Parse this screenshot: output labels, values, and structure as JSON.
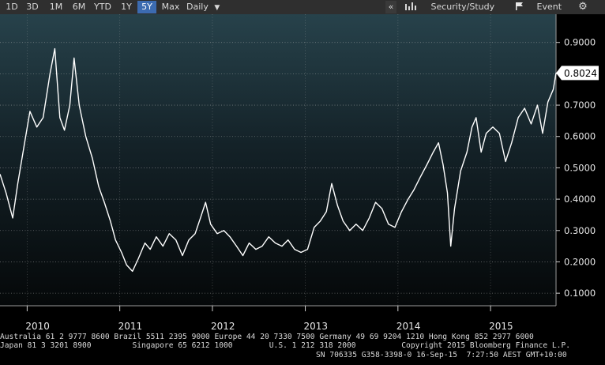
{
  "toolbar": {
    "ranges": [
      "1D",
      "3D",
      "1M",
      "6M",
      "YTD",
      "1Y",
      "5Y",
      "Max"
    ],
    "selected_range": "5Y",
    "frequency": "Daily",
    "collapse_glyph": "«",
    "security_study_label": "Security/Study",
    "event_label": "Event",
    "icons": [
      "dropdown-arrow-icon",
      "bar-chart-icon",
      "flag-icon",
      "gear-icon"
    ]
  },
  "chart_data": {
    "type": "line",
    "title": "",
    "xlabel": "",
    "ylabel": "",
    "x_tick_labels": [
      "2010",
      "2011",
      "2012",
      "2013",
      "2014",
      "2015"
    ],
    "y_tick_labels": [
      "0.1000",
      "0.2000",
      "0.3000",
      "0.4000",
      "0.5000",
      "0.6000",
      "0.7000",
      "0.8000",
      "0.9000"
    ],
    "ylim": [
      0.06,
      0.99
    ],
    "xlim": [
      "2009-09-16",
      "2015-09-16"
    ],
    "last_value_label": "0.8024",
    "last_value": 0.8024,
    "grid": true,
    "series": [
      {
        "color": "#ffffff",
        "points": [
          [
            "2009-09-16",
            0.48
          ],
          [
            "2009-10-10",
            0.42
          ],
          [
            "2009-11-05",
            0.34
          ],
          [
            "2009-11-25",
            0.45
          ],
          [
            "2009-12-20",
            0.57
          ],
          [
            "2010-01-12",
            0.68
          ],
          [
            "2010-02-08",
            0.63
          ],
          [
            "2010-03-05",
            0.66
          ],
          [
            "2010-04-01",
            0.8
          ],
          [
            "2010-04-20",
            0.88
          ],
          [
            "2010-05-10",
            0.66
          ],
          [
            "2010-05-28",
            0.62
          ],
          [
            "2010-06-18",
            0.7
          ],
          [
            "2010-07-05",
            0.85
          ],
          [
            "2010-07-25",
            0.7
          ],
          [
            "2010-08-20",
            0.6
          ],
          [
            "2010-09-15",
            0.53
          ],
          [
            "2010-10-10",
            0.44
          ],
          [
            "2010-11-01",
            0.39
          ],
          [
            "2010-11-25",
            0.33
          ],
          [
            "2010-12-15",
            0.27
          ],
          [
            "2011-01-08",
            0.23
          ],
          [
            "2011-01-28",
            0.19
          ],
          [
            "2011-02-20",
            0.17
          ],
          [
            "2011-03-15",
            0.21
          ],
          [
            "2011-04-10",
            0.26
          ],
          [
            "2011-05-01",
            0.24
          ],
          [
            "2011-05-25",
            0.28
          ],
          [
            "2011-06-20",
            0.25
          ],
          [
            "2011-07-15",
            0.29
          ],
          [
            "2011-08-10",
            0.27
          ],
          [
            "2011-09-05",
            0.22
          ],
          [
            "2011-09-30",
            0.27
          ],
          [
            "2011-10-25",
            0.29
          ],
          [
            "2011-11-15",
            0.34
          ],
          [
            "2011-12-05",
            0.39
          ],
          [
            "2011-12-25",
            0.32
          ],
          [
            "2012-01-20",
            0.29
          ],
          [
            "2012-02-15",
            0.3
          ],
          [
            "2012-03-10",
            0.28
          ],
          [
            "2012-04-05",
            0.25
          ],
          [
            "2012-04-30",
            0.22
          ],
          [
            "2012-05-25",
            0.26
          ],
          [
            "2012-06-20",
            0.24
          ],
          [
            "2012-07-15",
            0.25
          ],
          [
            "2012-08-10",
            0.28
          ],
          [
            "2012-09-05",
            0.26
          ],
          [
            "2012-10-01",
            0.25
          ],
          [
            "2012-10-25",
            0.27
          ],
          [
            "2012-11-20",
            0.24
          ],
          [
            "2012-12-15",
            0.23
          ],
          [
            "2013-01-10",
            0.24
          ],
          [
            "2013-02-05",
            0.31
          ],
          [
            "2013-03-01",
            0.33
          ],
          [
            "2013-03-25",
            0.36
          ],
          [
            "2013-04-15",
            0.45
          ],
          [
            "2013-05-08",
            0.38
          ],
          [
            "2013-05-30",
            0.33
          ],
          [
            "2013-06-25",
            0.3
          ],
          [
            "2013-07-20",
            0.32
          ],
          [
            "2013-08-15",
            0.3
          ],
          [
            "2013-09-10",
            0.34
          ],
          [
            "2013-10-05",
            0.39
          ],
          [
            "2013-10-30",
            0.37
          ],
          [
            "2013-11-25",
            0.32
          ],
          [
            "2013-12-20",
            0.31
          ],
          [
            "2014-01-15",
            0.36
          ],
          [
            "2014-02-10",
            0.4
          ],
          [
            "2014-03-05",
            0.43
          ],
          [
            "2014-03-30",
            0.47
          ],
          [
            "2014-04-25",
            0.51
          ],
          [
            "2014-05-20",
            0.55
          ],
          [
            "2014-06-10",
            0.58
          ],
          [
            "2014-06-28",
            0.51
          ],
          [
            "2014-07-15",
            0.42
          ],
          [
            "2014-07-28",
            0.25
          ],
          [
            "2014-08-12",
            0.37
          ],
          [
            "2014-09-05",
            0.49
          ],
          [
            "2014-09-30",
            0.55
          ],
          [
            "2014-10-20",
            0.63
          ],
          [
            "2014-11-05",
            0.66
          ],
          [
            "2014-11-25",
            0.55
          ],
          [
            "2014-12-15",
            0.61
          ],
          [
            "2015-01-10",
            0.63
          ],
          [
            "2015-02-05",
            0.61
          ],
          [
            "2015-03-01",
            0.52
          ],
          [
            "2015-03-25",
            0.58
          ],
          [
            "2015-04-20",
            0.66
          ],
          [
            "2015-05-15",
            0.69
          ],
          [
            "2015-06-10",
            0.64
          ],
          [
            "2015-07-05",
            0.7
          ],
          [
            "2015-07-25",
            0.61
          ],
          [
            "2015-08-15",
            0.71
          ],
          [
            "2015-09-05",
            0.75
          ],
          [
            "2015-09-16",
            0.8024
          ]
        ]
      }
    ]
  },
  "footer": {
    "line1": "Australia 61 2 9777 8600 Brazil 5511 2395 9000 Europe 44 20 7330 7500 Germany 49 69 9204 1210 Hong Kong 852 2977 6000",
    "line2": "Japan 81 3 3201 8900         Singapore 65 6212 1000        U.S. 1 212 318 2000          Copyright 2015 Bloomberg Finance L.P.",
    "line3": "SN 706335 G358-3398-0 16-Sep-15  7:27:50 AEST GMT+10:00"
  }
}
